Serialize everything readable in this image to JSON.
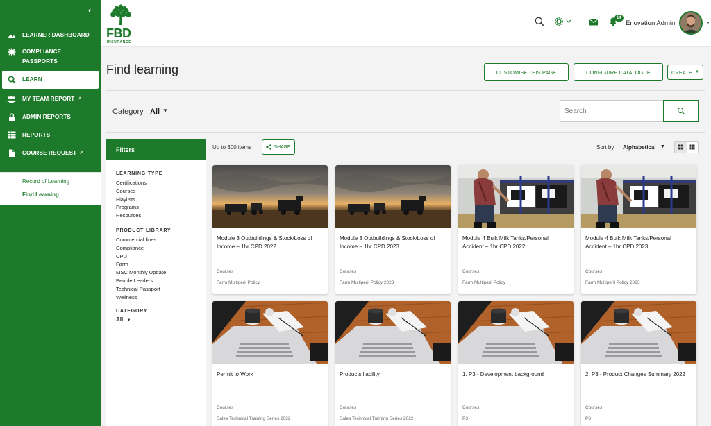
{
  "sidebar": {
    "items": [
      {
        "label": "LEARNER DASHBOARD",
        "icon": "dashboard-icon"
      },
      {
        "label": "COMPLIANCE PASSPORTS",
        "icon": "gear-icon"
      },
      {
        "label": "LEARN",
        "icon": "search-icon"
      },
      {
        "label": "MY TEAM REPORT",
        "icon": "team-icon"
      },
      {
        "label": "ADMIN REPORTS",
        "icon": "lock-icon"
      },
      {
        "label": "REPORTS",
        "icon": "table-icon"
      },
      {
        "label": "COURSE REQUEST",
        "icon": "document-icon"
      }
    ],
    "sub_items": [
      "Record of Learning",
      "Find Learning"
    ]
  },
  "header": {
    "brand": "FBD",
    "brand_sub": "INSURANCE",
    "notifications": "14",
    "user": "Enovation Admin"
  },
  "main": {
    "title": "Find learning",
    "customise_label": "CUSTOMISE THIS PAGE",
    "configure_label": "CONFIGURE CATALOGUE",
    "create_label": "CREATE",
    "category_label": "Category",
    "category_value": "All",
    "search_placeholder": "Search",
    "count_text": "Up to 300 items",
    "share_label": "SHARE",
    "sort_label": "Sort by",
    "sort_value": "Alphabetical"
  },
  "filters": {
    "title": "Filters",
    "learning_type_label": "LEARNING TYPE",
    "learning_types": [
      "Certifications",
      "Courses",
      "Playlists",
      "Programs",
      "Resources"
    ],
    "product_library_label": "PRODUCT LIBRARY",
    "product_library": [
      "Commercial lines",
      "Compliance",
      "CPD",
      "Farm",
      "MSC Monthly Update",
      "People Leaders",
      "Technical Passport",
      "Wellness"
    ],
    "category_label": "CATEGORY",
    "category_value": "All"
  },
  "cards": [
    {
      "title": "Module 3 Outbuildings & Stock/Loss of Income – 1hr CPD 2022",
      "type": "Courses",
      "category": "Farm Multiperil Policy",
      "image": "farm-sunset"
    },
    {
      "title": "Module 3 Outbuildings & Stock/Loss of Income – 1hr CPD 2023",
      "type": "Courses",
      "category": "Farm Multiperil Policy 2023",
      "image": "farm-sunset"
    },
    {
      "title": "Module 4 Bulk Milk Tanks/Personal Accident – 1hr CPD 2022",
      "type": "Courses",
      "category": "Farm Multiperil Policy",
      "image": "farmer-cows"
    },
    {
      "title": "Module 4 Bulk Milk Tanks/Personal Accident – 1hr CPD 2023",
      "type": "Courses",
      "category": "Farm Multiperil Policy 2023",
      "image": "farmer-cows"
    },
    {
      "title": "Permit to Work",
      "type": "Courses",
      "category": "Sales Technical Training Series 2022",
      "image": "desk-laptop"
    },
    {
      "title": "Products liability",
      "type": "Courses",
      "category": "Sales Technical Training Series 2022",
      "image": "desk-laptop"
    },
    {
      "title": "1. P3 - Development background",
      "type": "Courses",
      "category": "P3",
      "image": "desk-laptop"
    },
    {
      "title": "2. P3 - Product Changes Summary 2022",
      "type": "Courses",
      "category": "P3",
      "image": "desk-laptop"
    }
  ],
  "colors": {
    "brand": "#1c7a2a",
    "background": "#f3f3f3"
  }
}
